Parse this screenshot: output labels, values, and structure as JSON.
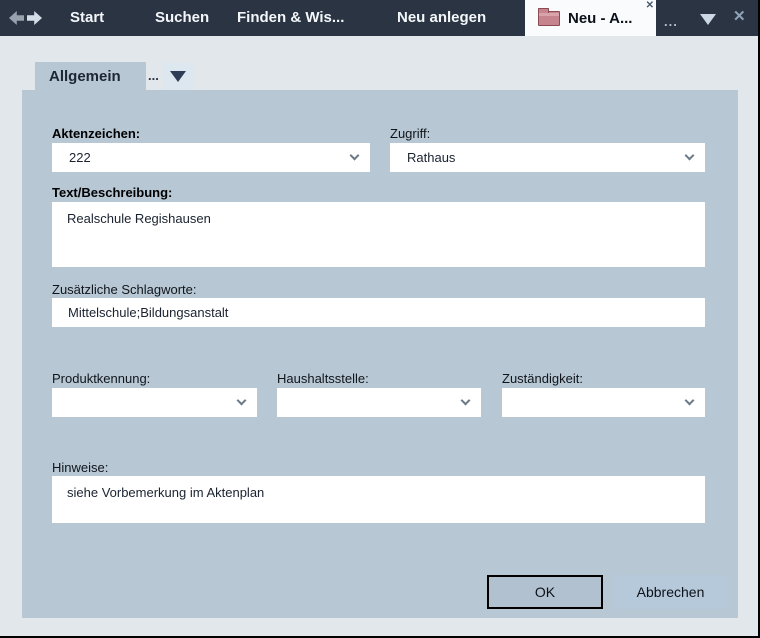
{
  "colors": {
    "topbar_bg": "#2a3443",
    "active_tab_bg": "#fafbfd",
    "page_bg": "#e2e7ec",
    "panel_bg": "#b8c7d4",
    "field_bg": "#ffffff",
    "ok_button_bg": "#b2c1cf",
    "cancel_button_bg": "#b6c9db",
    "folder_icon_color": "#c5848e"
  },
  "topbar": {
    "tabs": [
      {
        "label": "Start"
      },
      {
        "label": "Suchen"
      },
      {
        "label": "Finden & Wis..."
      },
      {
        "label": "Neu anlegen"
      }
    ],
    "active_tab": {
      "label": "Neu - A...",
      "icon": "folder-icon",
      "close_glyph": "✕"
    },
    "overflow_label": "...",
    "dropdown_icon": "chevron-down-triangle",
    "close_glyph": "✕"
  },
  "ribbon": {
    "tab_label": "Allgemein",
    "more_label": "...",
    "dropdown_icon": "chevron-down-triangle"
  },
  "form": {
    "aktenzeichen": {
      "label": "Aktenzeichen:",
      "value": "222"
    },
    "zugriff": {
      "label": "Zugriff:",
      "value": "Rathaus"
    },
    "beschreibung": {
      "label": "Text/Beschreibung:",
      "value": "Realschule Regishausen"
    },
    "schlagworte": {
      "label": "Zusätzliche Schlagworte:",
      "value": "Mittelschule;Bildungsanstalt"
    },
    "produktkennung": {
      "label": "Produktkennung:",
      "value": ""
    },
    "haushaltsstelle": {
      "label": "Haushaltsstelle:",
      "value": ""
    },
    "zustaendigkeit": {
      "label": "Zuständigkeit:",
      "value": ""
    },
    "hinweise": {
      "label": "Hinweise:",
      "value": "siehe Vorbemerkung im Aktenplan"
    },
    "buttons": {
      "ok": "OK",
      "cancel": "Abbrechen"
    }
  }
}
